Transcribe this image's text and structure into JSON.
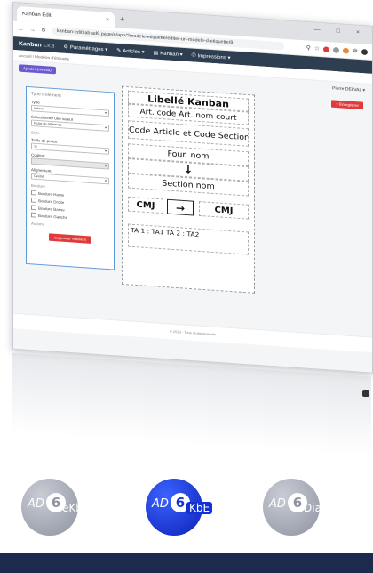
{
  "browser": {
    "tab_title": "Kanban Edit",
    "tab_close": "×",
    "new_tab": "+",
    "window_controls": "— □ ×",
    "url": "kanban-edit.lab.ad6.page/e/app/?modele-etiquette/editer-un-modele-d-etiquette/8"
  },
  "app": {
    "brand": "Kanban",
    "brand_sub": "E.K.B",
    "nav": [
      "Paramétrages ▾",
      "Articles ▾",
      "Kanban ▾",
      "Impressions ▾"
    ],
    "breadcrumb": "Accueil / Modèles d'étiquette",
    "primary_button": "Ajouter (niveau)",
    "user": "Pierre DELVAL ▾",
    "save_button": "+ Enregistrer"
  },
  "panel": {
    "heading": "Type d'élément",
    "fields": [
      {
        "label": "Type",
        "value": "Valeur"
      },
      {
        "label": "Sélectionner une valeur",
        "value": "Fiche de référence"
      },
      {
        "label": "Style",
        "value": ""
      },
      {
        "label": "Taille de police",
        "value": "11"
      },
      {
        "label": "Couleur",
        "value": ""
      },
      {
        "label": "Alignement",
        "value": "Centré"
      }
    ],
    "borders_heading": "Bordure",
    "borders": [
      "Bordure Haute",
      "Bordure Droite",
      "Bordure Basse",
      "Bordure Gauche"
    ],
    "actions_heading": "Actions",
    "delete_button": "Supprimer l'élément"
  },
  "label": {
    "title": "Libellé Kanban",
    "line1": "Art. code Art. nom court",
    "line2": "Code Article et Code Section",
    "line3": "Four. nom",
    "arrow": "↓",
    "line4": "Section nom",
    "cmj_left": "CMJ",
    "cmj_arrow": "→",
    "cmj_right": "CMJ",
    "ta_row": "TA 1 : TA1        TA 2 : TA2"
  },
  "footer": "© 2020 - Tous droits réservés",
  "logos": [
    {
      "ad": "AD",
      "six": "6",
      "suffix": "eKb"
    },
    {
      "ad": "AD",
      "six": "6",
      "suffix": "KbE"
    },
    {
      "ad": "AD",
      "six": "6",
      "suffix": "Diag"
    }
  ],
  "colors": {
    "nav_bg": "#2c3e50",
    "primary": "#6a5acd",
    "danger": "#e03b3b",
    "panel_border": "#5d9ad8",
    "logo_blue": "#1131d4",
    "bottom_bar": "#1c2a4e"
  }
}
